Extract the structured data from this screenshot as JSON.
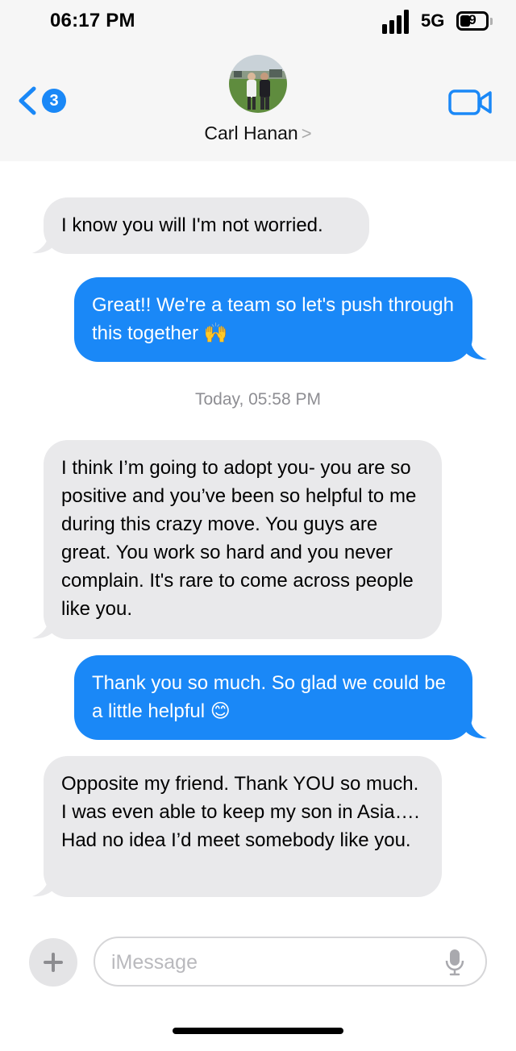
{
  "status_bar": {
    "time": "06:17 PM",
    "network": "5G",
    "battery": "9"
  },
  "header": {
    "back_badge": "3",
    "contact_name": "Carl Hanan",
    "contact_chevron": ">"
  },
  "conversation": {
    "messages": [
      {
        "side": "received",
        "text": "I know you will I'm not worried."
      },
      {
        "side": "sent",
        "text": "Great!! We're a team so let's push through this together 🙌"
      },
      {
        "side": "received",
        "text": "I think I’m going to adopt you- you are so positive and you’ve been so helpful to me during this crazy move. You guys are great. You work so hard and you never complain. It's rare to come across people like you."
      },
      {
        "side": "sent",
        "text": "Thank you so much. So glad we could be a little helpful 😊"
      },
      {
        "side": "received",
        "text": "Opposite my friend.  Thank YOU so much. I was even able to keep my son in Asia…. Had no idea I’d meet somebody like you."
      }
    ],
    "timestamp": "Today, 05:58 PM"
  },
  "composer": {
    "placeholder": "iMessage"
  },
  "colors": {
    "sent_bubble": "#1a88f7",
    "received_bubble": "#e9e9eb",
    "accent": "#1a88f7"
  },
  "icons": [
    "back-chevron-icon",
    "video-camera-icon",
    "plus-icon",
    "microphone-icon",
    "signal-icon",
    "battery-icon"
  ]
}
